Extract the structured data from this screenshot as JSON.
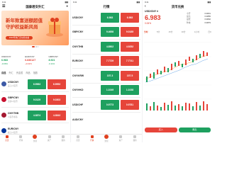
{
  "app": {
    "brand_color": "#e0401f",
    "up_color": "#e23b2e",
    "down_color": "#18a05a"
  },
  "status": {
    "time": "9:41",
    "signal": "▮▮▮"
  },
  "home": {
    "title": "国泰君安外汇",
    "menu_icon": "menu-icon",
    "message_icon": "bell-icon",
    "banner": {
      "line1": "新年致富送额超值",
      "line2": "守护权益新风尚",
      "cta": "2020年热门活动抢先看"
    },
    "quotes": [
      {
        "name": "USD/CNY",
        "value": "6.983",
        "change": "-0.06%"
      },
      {
        "name": "EUR/CNY",
        "value": "6.836127",
        "change": "+0.02%"
      },
      {
        "name": "GBP/CNY",
        "value": "8.521",
        "change": "-0.11%"
      }
    ],
    "tabs": [
      "自选",
      "外汇",
      "贵金属",
      "商品",
      "指数"
    ],
    "rows": [
      {
        "pair": "USD/CNY",
        "sub": "美元/人民币",
        "flag": "#3c5aa6",
        "sell": "6.9983",
        "buy": "6.9953"
      },
      {
        "pair": "GBP/CNY",
        "sub": "英镑/人民币",
        "flag": "#c8102e",
        "sell": "9.0129",
        "buy": "9.0303"
      },
      {
        "pair": "CNY/THB",
        "sub": "人民币/泰铢",
        "flag": "#a51931",
        "sell": "4.3874",
        "buy": "4.3843"
      },
      {
        "pair": "EUR/CNY",
        "sub": "欧元/人民币",
        "flag": "#003399",
        "sell": "7.7721",
        "buy": "7.7748"
      }
    ],
    "nav": [
      "首页",
      "行情",
      "交易",
      "资产",
      "我的"
    ]
  },
  "market": {
    "title": "行情",
    "rows": [
      {
        "pair": "USD/CNY",
        "sell": "6.983",
        "buy": "6.983"
      },
      {
        "pair": "GBP/CNY",
        "sell": "9.4658",
        "buy": "9.0185"
      },
      {
        "pair": "CNY/THB",
        "sell": "4.8502",
        "buy": "4.9252"
      },
      {
        "pair": "EUR/CNY",
        "sell": "7.7729",
        "buy": "7.7741"
      },
      {
        "pair": "CNY/KRW",
        "sell": "157.3",
        "buy": "157.5"
      },
      {
        "pair": "CNY/HKD",
        "sell": "1.1049",
        "buy": "1.1038"
      },
      {
        "pair": "USD/CHF",
        "sell": "0.9773",
        "buy": "0.9781"
      },
      {
        "pair": "AUD/CNY",
        "sell": "4.7721",
        "buy": "4.7748"
      }
    ],
    "nav": [
      "首页",
      "行情",
      "交易",
      "资产",
      "我的"
    ]
  },
  "detail": {
    "title": "货币兑换",
    "symbol": "USD/CNY ▾",
    "price": "6.983",
    "change": "0.06%",
    "stats": [
      {
        "k": "今开",
        "v": "6.9831"
      },
      {
        "k": "最高",
        "v": "6.9855"
      },
      {
        "k": "最低",
        "v": "6.9802"
      },
      {
        "k": "昨收",
        "v": "6.9879"
      }
    ],
    "timeframes": [
      "分时",
      "5分",
      "15分",
      "30分",
      "1小时",
      "日K"
    ],
    "buy": "买入",
    "sell": "卖出"
  }
}
